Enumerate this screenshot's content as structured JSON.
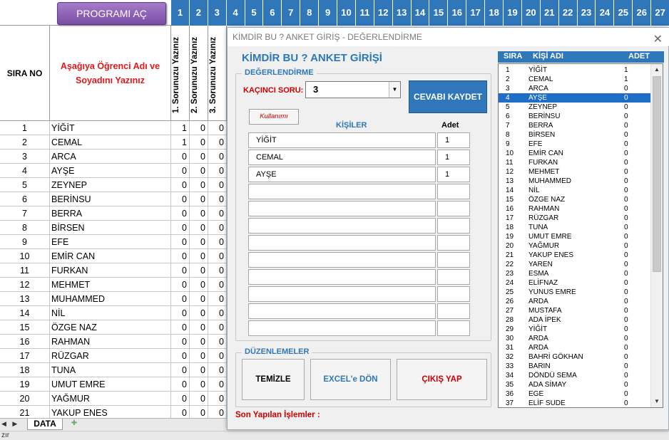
{
  "sheet": {
    "program_button": "PROGRAMI AÇ",
    "col_numbers": [
      "1",
      "2",
      "3",
      "4",
      "5",
      "6",
      "7",
      "8",
      "9",
      "10",
      "11",
      "12",
      "13",
      "14",
      "15",
      "16",
      "17",
      "18",
      "19",
      "20",
      "21",
      "22",
      "23",
      "24",
      "25",
      "26",
      "27"
    ],
    "hdr_sira": "SIRA NO",
    "hdr_adi": "Aşağıya Öğrenci Adı ve Soyadını Yazınız",
    "hdr_q": [
      "1. Sorunuzu Yazınız",
      "2. Sorunuzu Yazınız",
      "3. Sorunuzu Yazınız"
    ],
    "rows": [
      {
        "no": "1",
        "name": "YİĞİT",
        "v": [
          "1",
          "0",
          "0"
        ]
      },
      {
        "no": "2",
        "name": "CEMAL",
        "v": [
          "1",
          "0",
          "0"
        ]
      },
      {
        "no": "3",
        "name": "ARCA",
        "v": [
          "0",
          "0",
          "0"
        ]
      },
      {
        "no": "4",
        "name": "AYŞE",
        "v": [
          "0",
          "0",
          "0"
        ]
      },
      {
        "no": "5",
        "name": "ZEYNEP",
        "v": [
          "0",
          "0",
          "0"
        ]
      },
      {
        "no": "6",
        "name": "BERİNSU",
        "v": [
          "0",
          "0",
          "0"
        ]
      },
      {
        "no": "7",
        "name": "BERRA",
        "v": [
          "0",
          "0",
          "0"
        ]
      },
      {
        "no": "8",
        "name": "BİRSEN",
        "v": [
          "0",
          "0",
          "0"
        ]
      },
      {
        "no": "9",
        "name": "EFE",
        "v": [
          "0",
          "0",
          "0"
        ]
      },
      {
        "no": "10",
        "name": "EMİR CAN",
        "v": [
          "0",
          "0",
          "0"
        ]
      },
      {
        "no": "11",
        "name": "FURKAN",
        "v": [
          "0",
          "0",
          "0"
        ]
      },
      {
        "no": "12",
        "name": "MEHMET",
        "v": [
          "0",
          "0",
          "0"
        ]
      },
      {
        "no": "13",
        "name": "MUHAMMED",
        "v": [
          "0",
          "0",
          "0"
        ]
      },
      {
        "no": "14",
        "name": "NİL",
        "v": [
          "0",
          "0",
          "0"
        ]
      },
      {
        "no": "15",
        "name": "ÖZGE NAZ",
        "v": [
          "0",
          "0",
          "0"
        ]
      },
      {
        "no": "16",
        "name": "RAHMAN",
        "v": [
          "0",
          "0",
          "0"
        ]
      },
      {
        "no": "17",
        "name": "RÜZGAR",
        "v": [
          "0",
          "0",
          "0"
        ]
      },
      {
        "no": "18",
        "name": "TUNA",
        "v": [
          "0",
          "0",
          "0"
        ]
      },
      {
        "no": "19",
        "name": "UMUT EMRE",
        "v": [
          "0",
          "0",
          "0"
        ]
      },
      {
        "no": "20",
        "name": "YAĞMUR",
        "v": [
          "0",
          "0",
          "0"
        ]
      },
      {
        "no": "21",
        "name": "YAKUP ENES",
        "v": [
          "0",
          "0",
          "0"
        ]
      }
    ],
    "tab_name": "DATA",
    "status_text": "zır"
  },
  "dialog": {
    "title": "KİMDİR BU ? ANKET GİRİŞ - DEĞERLENDİRME",
    "form_title": "KİMDİR BU ? ANKET GİRİŞİ",
    "group1": "DEĞERLENDİRME",
    "soru_label": "KAÇINCI SORU:",
    "soru_value": "3",
    "kaydet_button": "CEVABI KAYDET",
    "kullanimi_button": "Kullanımı",
    "kisiler_header": "KİŞİLER",
    "adet_header": "Adet",
    "entries": [
      {
        "name": "YİĞİT",
        "count": "1"
      },
      {
        "name": "CEMAL",
        "count": "1"
      },
      {
        "name": "AYŞE",
        "count": "1"
      },
      {
        "name": "",
        "count": ""
      },
      {
        "name": "",
        "count": ""
      },
      {
        "name": "",
        "count": ""
      },
      {
        "name": "",
        "count": ""
      },
      {
        "name": "",
        "count": ""
      },
      {
        "name": "",
        "count": ""
      },
      {
        "name": "",
        "count": ""
      },
      {
        "name": "",
        "count": ""
      },
      {
        "name": "",
        "count": ""
      }
    ],
    "group2": "DÜZENLEMELER",
    "temizle_button": "TEMİZLE",
    "excel_button": "EXCEL'e DÖN",
    "cikis_button": "ÇIKIŞ YAP",
    "son_label": "Son Yapılan İşlemler :",
    "list_headers": {
      "sira": "SIRA",
      "adi": "KİŞİ ADI",
      "adet": "ADET"
    },
    "list_selected_index": 3,
    "list": [
      {
        "no": "1",
        "name": "YİĞİT",
        "adet": "1"
      },
      {
        "no": "2",
        "name": "CEMAL",
        "adet": "1"
      },
      {
        "no": "3",
        "name": "ARCA",
        "adet": "0"
      },
      {
        "no": "4",
        "name": "AYŞE",
        "adet": "0"
      },
      {
        "no": "5",
        "name": "ZEYNEP",
        "adet": "0"
      },
      {
        "no": "6",
        "name": "BERİNSU",
        "adet": "0"
      },
      {
        "no": "7",
        "name": "BERRA",
        "adet": "0"
      },
      {
        "no": "8",
        "name": "BİRSEN",
        "adet": "0"
      },
      {
        "no": "9",
        "name": "EFE",
        "adet": "0"
      },
      {
        "no": "10",
        "name": "EMİR CAN",
        "adet": "0"
      },
      {
        "no": "11",
        "name": "FURKAN",
        "adet": "0"
      },
      {
        "no": "12",
        "name": "MEHMET",
        "adet": "0"
      },
      {
        "no": "13",
        "name": "MUHAMMED",
        "adet": "0"
      },
      {
        "no": "14",
        "name": "NİL",
        "adet": "0"
      },
      {
        "no": "15",
        "name": "ÖZGE NAZ",
        "adet": "0"
      },
      {
        "no": "16",
        "name": "RAHMAN",
        "adet": "0"
      },
      {
        "no": "17",
        "name": "RÜZGAR",
        "adet": "0"
      },
      {
        "no": "18",
        "name": "TUNA",
        "adet": "0"
      },
      {
        "no": "19",
        "name": "UMUT EMRE",
        "adet": "0"
      },
      {
        "no": "20",
        "name": "YAĞMUR",
        "adet": "0"
      },
      {
        "no": "21",
        "name": "YAKUP ENES",
        "adet": "0"
      },
      {
        "no": "22",
        "name": "YAREN",
        "adet": "0"
      },
      {
        "no": "23",
        "name": "ESMA",
        "adet": "0"
      },
      {
        "no": "24",
        "name": "ELİFNAZ",
        "adet": "0"
      },
      {
        "no": "25",
        "name": "YUNUS EMRE",
        "adet": "0"
      },
      {
        "no": "26",
        "name": "ARDA",
        "adet": "0"
      },
      {
        "no": "27",
        "name": "MUSTAFA",
        "adet": "0"
      },
      {
        "no": "28",
        "name": "ADA İPEK",
        "adet": "0"
      },
      {
        "no": "29",
        "name": "YİĞİT",
        "adet": "0"
      },
      {
        "no": "30",
        "name": "ARDA",
        "adet": "0"
      },
      {
        "no": "31",
        "name": "ARDA",
        "adet": "0"
      },
      {
        "no": "32",
        "name": "BAHRİ GÖKHAN",
        "adet": "0"
      },
      {
        "no": "33",
        "name": "BARIN",
        "adet": "0"
      },
      {
        "no": "34",
        "name": "DÖNDÜ SEMA",
        "adet": "0"
      },
      {
        "no": "35",
        "name": "ADA SİMAY",
        "adet": "0"
      },
      {
        "no": "36",
        "name": "EGE",
        "adet": "0"
      },
      {
        "no": "37",
        "name": "ELİF SUDE",
        "adet": "0"
      }
    ]
  },
  "colors": {
    "accent": "#2f77b9",
    "label_red": "#c00000",
    "selection": "#1e6ec8",
    "button_purple": "#8a5cb6"
  },
  "icons": {
    "close": "close-icon",
    "dropdown": "chevron-down-icon",
    "scroll_up": "arrow-up-icon",
    "scroll_down": "arrow-down-icon"
  }
}
